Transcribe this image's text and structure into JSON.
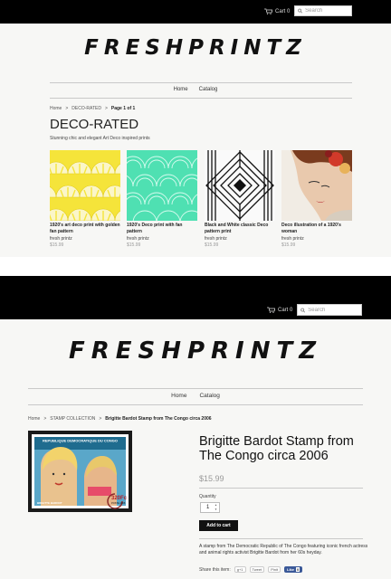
{
  "header": {
    "cart_label": "Cart 0",
    "search_placeholder": "Search",
    "logo": "FRESHPRINTZ"
  },
  "nav": {
    "items": [
      "Home",
      "Catalog"
    ]
  },
  "collection_page": {
    "breadcrumb": [
      "Home",
      "DECO-RATED",
      "Page 1 of 1"
    ],
    "title": "DECO-RATED",
    "description": "Stunning chic and elegant Art Deco inspired prints",
    "products": [
      {
        "title": "1920's art deco print with golden fan pattern",
        "vendor": "fresh printz",
        "price": "$15.99"
      },
      {
        "title": "1920's Deco print with fan pattern",
        "vendor": "fresh printz",
        "price": "$15.99"
      },
      {
        "title": "Black and White classic Deco pattern print",
        "vendor": "fresh printz",
        "price": "$15.99"
      },
      {
        "title": "Deco illustration of a 1920's woman",
        "vendor": "fresh printz",
        "price": "$15.99"
      }
    ]
  },
  "product_page": {
    "breadcrumb": [
      "Home",
      "STAMP COLLECTION",
      "Brigitte Bardot Stamp from The Congo circa 2006"
    ],
    "title": "Brigitte Bardot Stamp from The Congo circa 2006",
    "price": "$15.99",
    "quantity_label": "Quantity",
    "quantity_value": "1",
    "add_to_cart": "Add to cart",
    "description": "A stamp from The Democratic Republic of The Congo featuring iconic french actress and animal rights activist Brigitte Bardot from her 60s heyday.",
    "share_label": "Share this item:",
    "share_buttons": [
      "g+1",
      "Tweet",
      "Pinit",
      "Like",
      "0"
    ],
    "stamp_text": {
      "country": "REPUBLIQUE DEMOCRATIQUE DU CONGO",
      "value": "320Fc",
      "name": "BRIGITTE BARDOT",
      "post": "POSTE 2006"
    }
  },
  "colors": {
    "topbar": "#000000",
    "page_bg": "#f7f7f5",
    "yellow_print": "#f5e43a",
    "mint_print": "#4fe0b2",
    "button": "#111111",
    "fb_blue": "#3b5998"
  }
}
